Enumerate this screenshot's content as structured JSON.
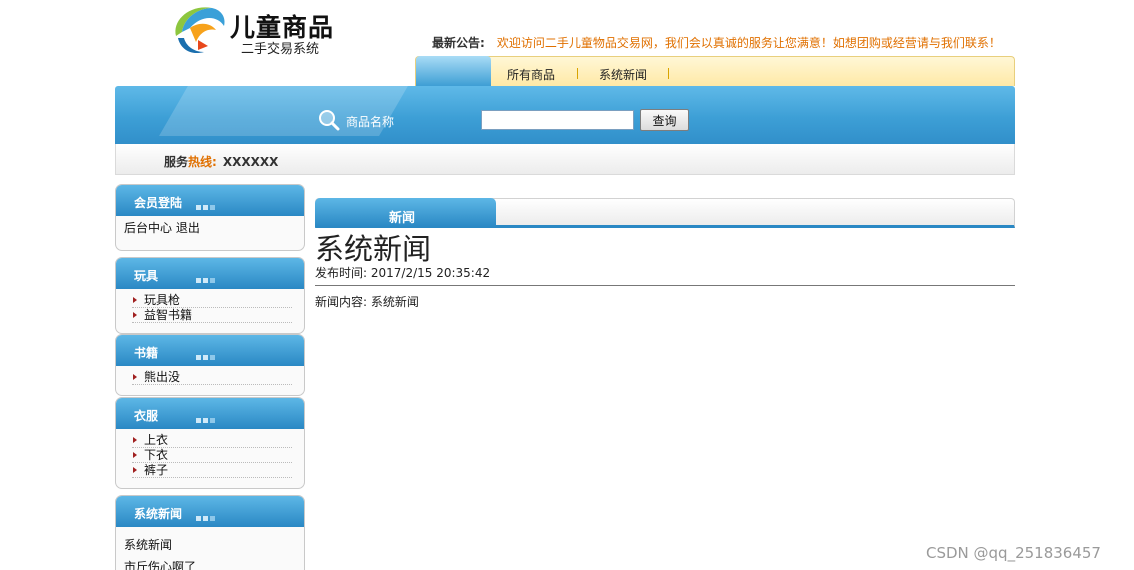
{
  "header": {
    "logo_title": "儿童商品",
    "logo_subtitle": "二手交易系统",
    "notice_label": "最新公告:",
    "notice_text": "欢迎访问二手儿童物品交易网，我们会以真诚的服务让您满意！如想团购或经营请与我们联系！"
  },
  "nav": {
    "items": [
      {
        "label": "所有商品"
      },
      {
        "label": "系统新闻"
      }
    ]
  },
  "search": {
    "label": "商品名称",
    "value": "",
    "button_label": "查询"
  },
  "hotline": {
    "prefix": "服务",
    "highlight": "热线:",
    "number": "XXXXXX"
  },
  "sidebar": {
    "login": {
      "title": "会员登陆",
      "text": "后台中心 退出"
    },
    "toys": {
      "title": "玩具",
      "items": [
        "玩具枪",
        "益智书籍"
      ]
    },
    "books": {
      "title": "书籍",
      "items": [
        "熊出没"
      ]
    },
    "clothes": {
      "title": "衣服",
      "items": [
        "上衣",
        "下衣",
        "裤子"
      ]
    },
    "news": {
      "title": "系统新闻",
      "items": [
        "系统新闻",
        "市斤伤心啊了"
      ]
    }
  },
  "main": {
    "tab_label": "新闻",
    "title": "系统新闻",
    "time": "发布时间: 2017/2/15 20:35:42",
    "content": "新闻内容: 系统新闻"
  },
  "watermark": "CSDN @qq_251836457",
  "colors": {
    "accent_blue": "#2a88c4",
    "notice_orange": "#e07000",
    "nav_yellow": "#ffe9a6"
  }
}
